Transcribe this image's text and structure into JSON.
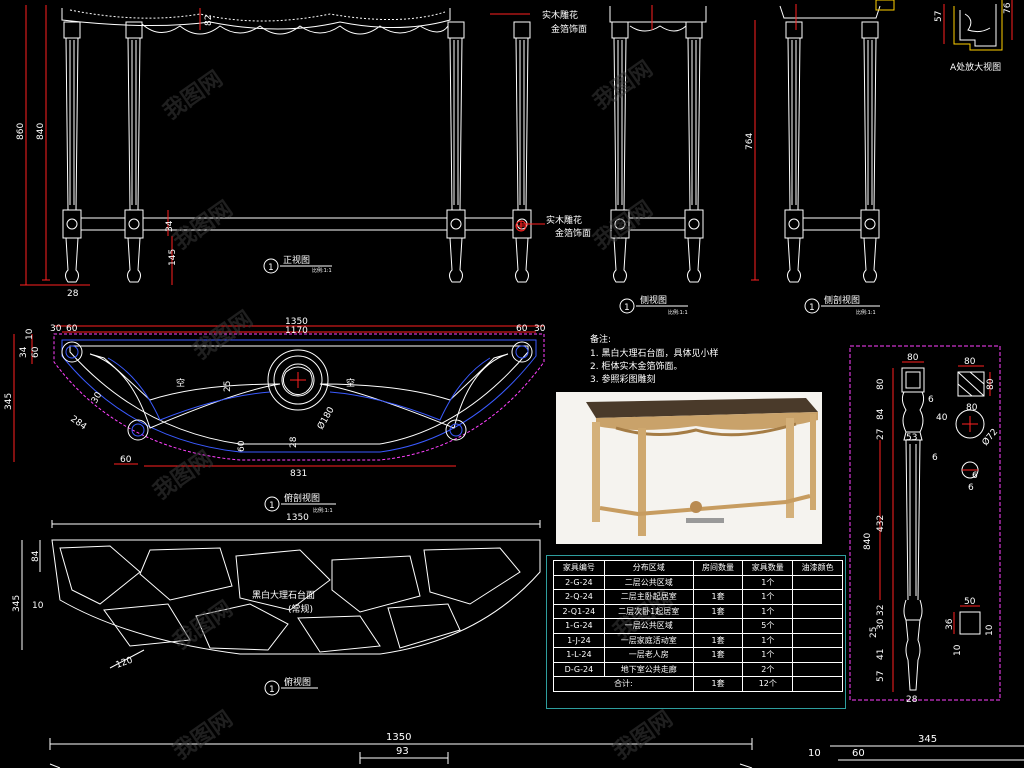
{
  "views": {
    "front": {
      "title": "正视图",
      "scale": "比例:1:1",
      "num": "1"
    },
    "side": {
      "title": "侧视图",
      "scale": "比例:1:1",
      "num": "1"
    },
    "side_section": {
      "title": "侧剖视图",
      "scale": "比例:1:1",
      "num": "1"
    },
    "plan_section": {
      "title": "俯剖视图",
      "scale": "比例:1:1",
      "num": "1"
    },
    "top": {
      "title": "俯视图",
      "num": "1"
    },
    "detail_a": {
      "title": "A处放大视图"
    }
  },
  "annotations": {
    "carving1": [
      "实木雕花",
      "金箔饰面"
    ],
    "carving2": [
      "实木雕花",
      "金箔饰面"
    ],
    "void_left": "空",
    "void_right": "空",
    "marble_line1": "黑白大理石台面",
    "marble_line2": "(常规)"
  },
  "dimensions": {
    "front_860": "860",
    "front_840": "840",
    "front_82": "82",
    "front_34": "34",
    "front_145": "145",
    "front_28": "28",
    "side_764": "764",
    "detail_57": "57",
    "detail_76": "76",
    "plan_1350": "1350",
    "plan_1170": "1170",
    "plan_30a": "30",
    "plan_60a": "60",
    "plan_60b": "60",
    "plan_30b": "30",
    "plan_10": "10",
    "plan_34": "34",
    "plan_60c": "60",
    "plan_345": "345",
    "plan_30c": "30",
    "plan_284": "284",
    "plan_180": "Ø180",
    "plan_831": "831",
    "plan_60d": "60",
    "plan_25": "25",
    "plan_60e": "60",
    "plan_28": "28",
    "top_1350": "1350",
    "top_84": "84",
    "top_345": "345",
    "top_10": "10",
    "top_120": "120",
    "bottom_1350": "1350",
    "bottom_93": "93",
    "bottom_345": "345",
    "bottom_10": "10",
    "bottom_60": "60",
    "leg_80a": "80",
    "leg_80b": "80",
    "leg_80c": "80",
    "leg_80d": "80",
    "leg_80e": "80",
    "leg_84": "84",
    "leg_27": "27",
    "leg_53": "53",
    "leg_6": "6",
    "leg_40": "40",
    "leg_6b": "6",
    "leg_72": "Ø72",
    "leg_6c": "6",
    "leg_6d": "6",
    "leg_840": "840",
    "leg_432": "432",
    "leg_32": "32",
    "leg_30": "30",
    "leg_25": "25",
    "leg_41": "41",
    "leg_28": "28",
    "leg_57": "57",
    "leg_50": "50",
    "leg_36": "36",
    "leg_10": "10",
    "leg_10b": "10"
  },
  "notes": {
    "heading": "备注:",
    "items": [
      "1. 黑白大理石台面，具体见小样",
      "2. 柜体实木金箔饰面。",
      "3. 参照彩图雕刻"
    ]
  },
  "watermark": "我图网",
  "schedule": {
    "headers": [
      "家具编号",
      "分布区域",
      "房间数量",
      "家具数量",
      "油漆颜色"
    ],
    "rows": [
      [
        "2-G-24",
        "二层公共区域",
        "",
        "1个",
        ""
      ],
      [
        "2-Q-24",
        "二层主卧起居室",
        "1套",
        "1个",
        ""
      ],
      [
        "2-Q1-24",
        "二层次卧1起居室",
        "1套",
        "1个",
        ""
      ],
      [
        "1-G-24",
        "一层公共区域",
        "",
        "5个",
        ""
      ],
      [
        "1-J-24",
        "一层家庭活动室",
        "1套",
        "1个",
        ""
      ],
      [
        "1-L-24",
        "一层老人房",
        "1套",
        "1个",
        ""
      ],
      [
        "D-G-24",
        "地下室公共走廊",
        "",
        "2个",
        ""
      ]
    ],
    "total": [
      "合计:",
      "1套",
      "12个",
      ""
    ]
  },
  "colors": {
    "line": "#ffffff",
    "dim": "#ff2020",
    "dashed": "#ff40ff",
    "blue": "#3a5aff",
    "cyan": "#2e9e9e",
    "yellow": "#ffd000"
  }
}
